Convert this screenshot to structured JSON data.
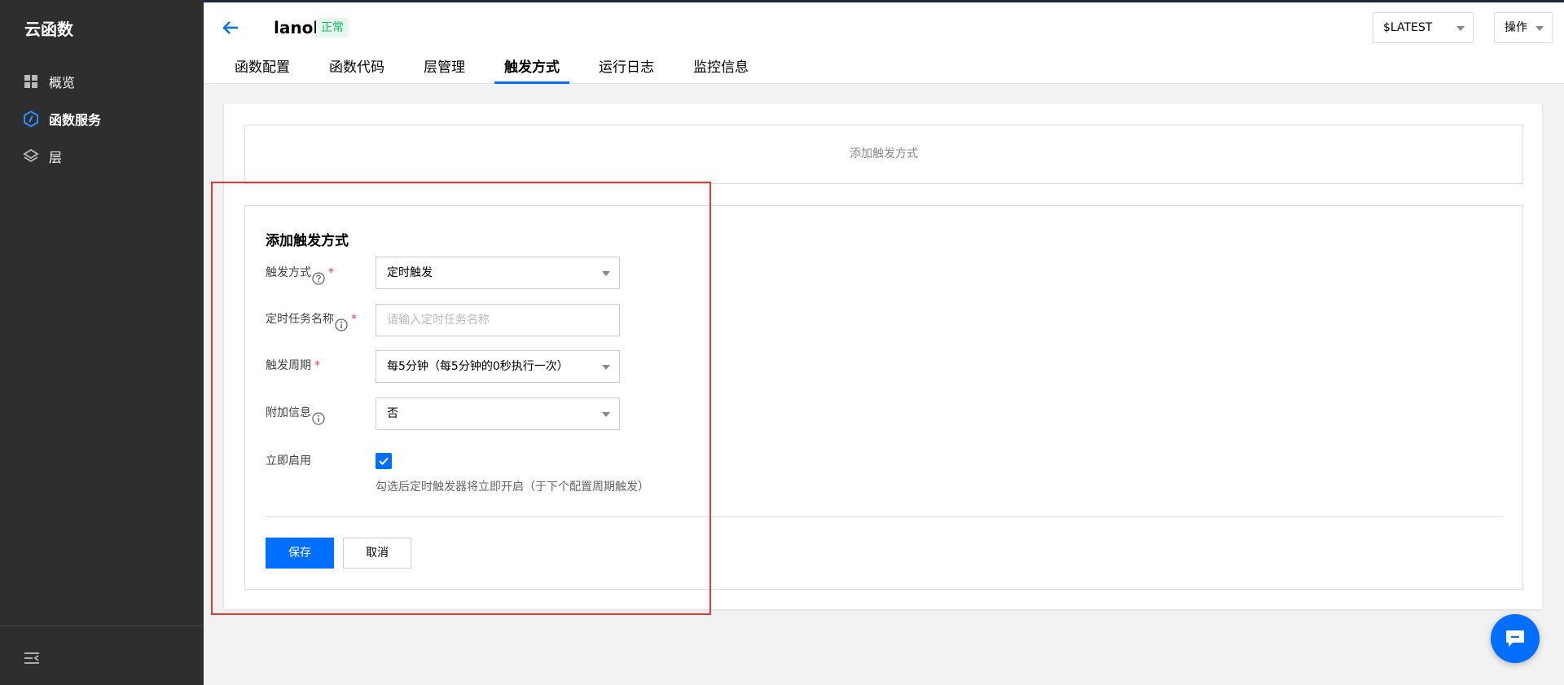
{
  "app": {
    "title": "云函数"
  },
  "sidebar": {
    "items": [
      {
        "label": "概览",
        "icon": "grid-icon",
        "active": false
      },
      {
        "label": "函数服务",
        "icon": "function-icon",
        "active": true
      },
      {
        "label": "层",
        "icon": "layers-icon",
        "active": false
      }
    ]
  },
  "header": {
    "function_name": "lanol",
    "status": "正常",
    "tabs": [
      "函数配置",
      "函数代码",
      "层管理",
      "触发方式",
      "运行日志",
      "监控信息"
    ],
    "active_tab": "触发方式",
    "version": "$LATEST",
    "ops_label": "操作"
  },
  "trigger": {
    "add_label": "添加触发方式",
    "form_title": "添加触发方式",
    "fields": {
      "type": {
        "label": "触发方式",
        "value": "定时触发"
      },
      "name": {
        "label": "定时任务名称",
        "placeholder": "请输入定时任务名称"
      },
      "period": {
        "label": "触发周期",
        "value": "每5分钟（每5分钟的0秒执行一次）"
      },
      "extra": {
        "label": "附加信息",
        "value": "否"
      },
      "enable": {
        "label": "立即启用",
        "checked": true,
        "hint": "勾选后定时触发器将立即开启（于下个配置周期触发）"
      }
    },
    "required_mark": "*",
    "save_label": "保存",
    "cancel_label": "取消"
  },
  "colors": {
    "primary": "#006eff",
    "sidebar_bg": "#2e2e2e",
    "status_green": "#0abf5b",
    "highlight": "#e53935"
  }
}
